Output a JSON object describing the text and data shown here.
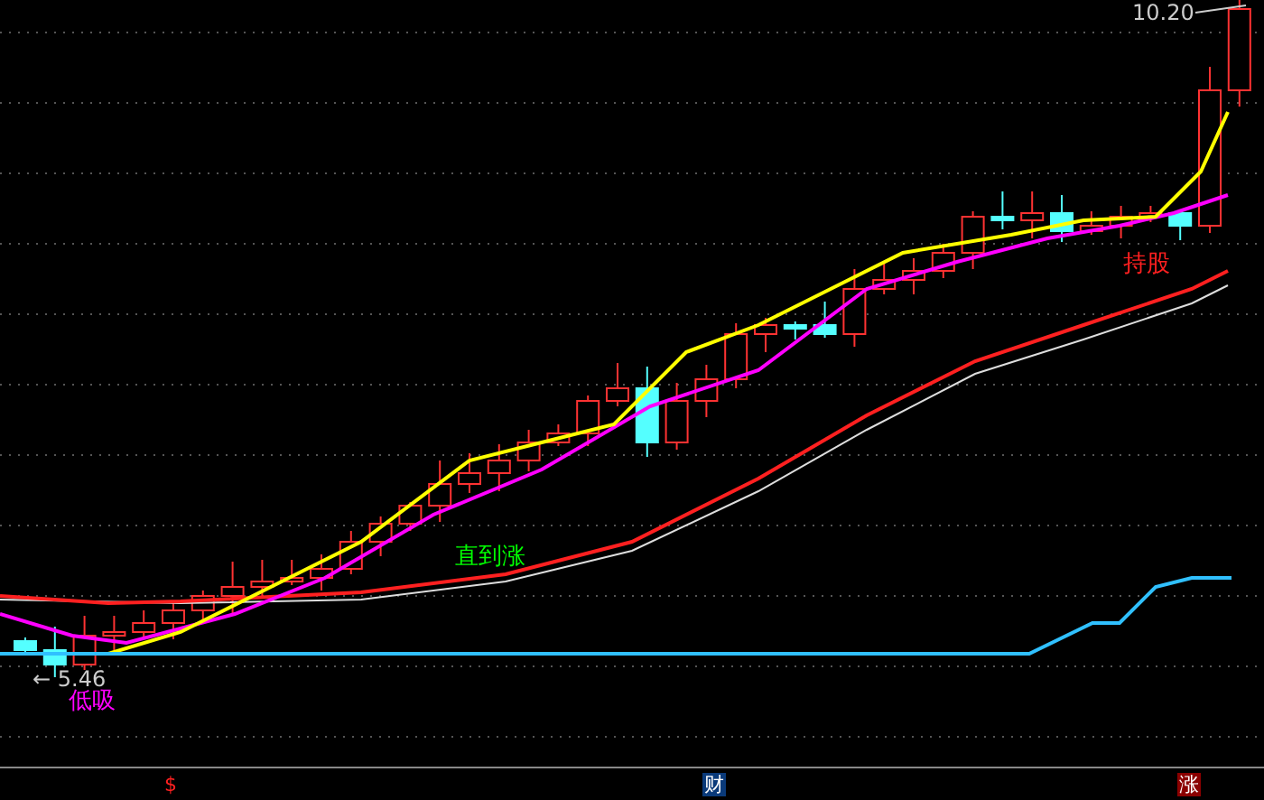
{
  "chart": {
    "high_label": "10.20",
    "low_label": "← 5.46",
    "annotations": [
      {
        "text": "直到涨",
        "color": "#00ff00"
      },
      {
        "text": "低吸",
        "color": "#ff00ff"
      },
      {
        "text": "持股",
        "color": "#ff2020"
      }
    ]
  },
  "markers": [
    {
      "text": "$",
      "kind": "plain"
    },
    {
      "text": "财",
      "kind": "boxed-blue"
    },
    {
      "text": "涨",
      "kind": "boxed-red"
    }
  ]
}
